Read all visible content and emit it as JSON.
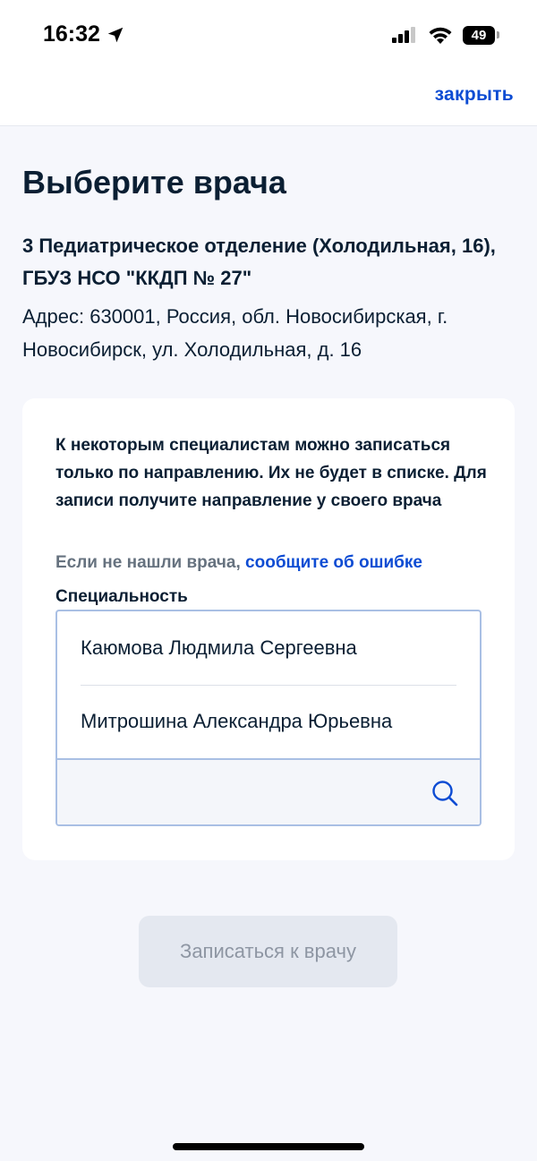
{
  "status_bar": {
    "time": "16:32",
    "battery": "49",
    "icons": [
      "location-arrow-icon",
      "cellular-signal-icon",
      "wifi-icon",
      "battery-icon"
    ]
  },
  "header": {
    "close_label": "закрыть"
  },
  "page": {
    "title": "Выберите врача",
    "department": "3 Педиатрическое отделение (Холодильная, 16), ГБУЗ НСО \"ККДП № 27\"",
    "address": "Адрес: 630001, Россия, обл. Новосибирская, г. Новосибирск, ул. Холодильная, д. 16"
  },
  "card": {
    "notice": "К некоторым специалистам можно записаться только по направлению. Их не будет в списке. Для записи получите направление у своего врача",
    "hint_prefix": "Если не нашли врача,",
    "hint_link": "сообщите об ошибке",
    "specialty_label": "Специальность",
    "doctors": [
      "Каюмова Людмила Сергеевна",
      "Митрошина Александра Юрьевна"
    ],
    "search_value": ""
  },
  "actions": {
    "submit_label": "Записаться к врачу"
  },
  "colors": {
    "accent": "#0d4cd3",
    "text": "#0b1f33",
    "muted": "#66727f",
    "background": "#f6f7fc",
    "button_disabled_bg": "#e4e8f0",
    "button_disabled_text": "#8e96a3",
    "field_border": "#a9bfe4"
  }
}
